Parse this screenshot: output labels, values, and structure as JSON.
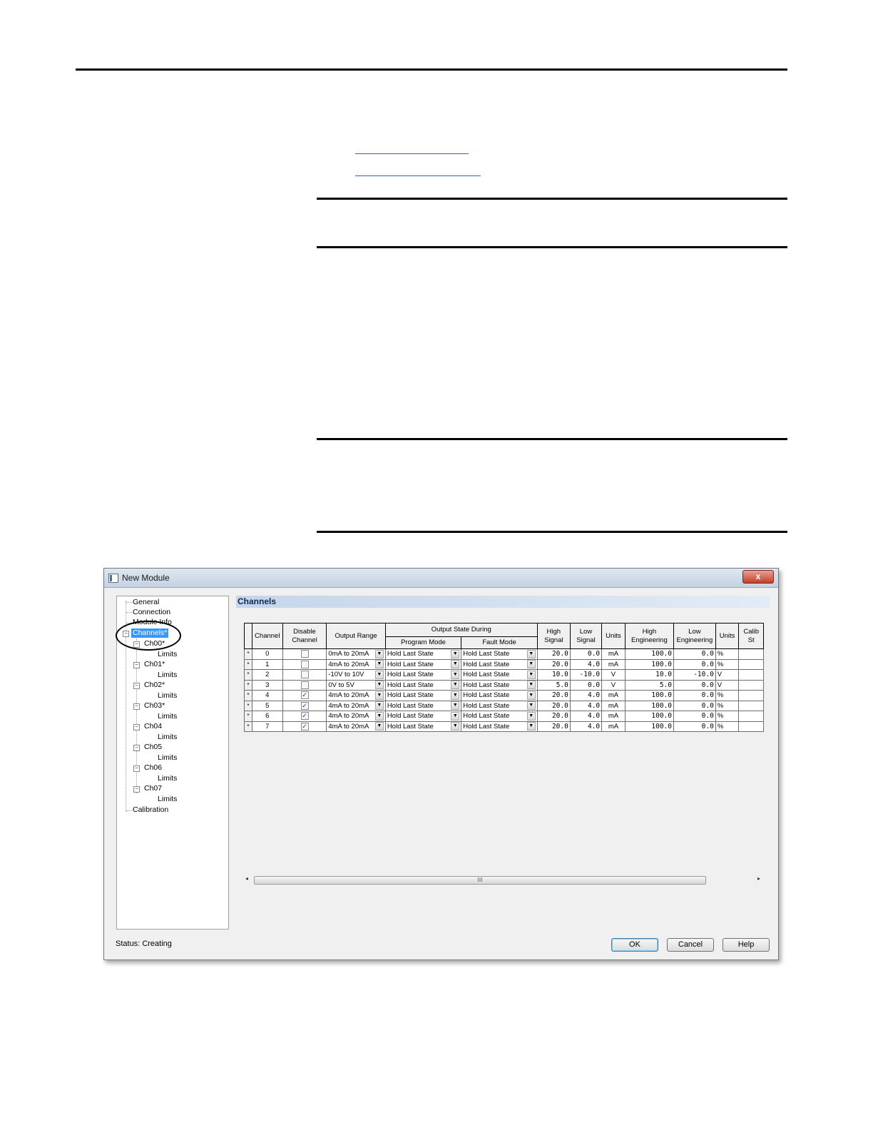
{
  "window": {
    "title": "New Module",
    "close_label": "x"
  },
  "tree": {
    "items": [
      {
        "label": "General"
      },
      {
        "label": "Connection"
      },
      {
        "label": "Module Info"
      },
      {
        "label": "Channels*"
      },
      {
        "label": "Ch00*"
      },
      {
        "label": "Limits"
      },
      {
        "label": "Ch01*"
      },
      {
        "label": "Limits"
      },
      {
        "label": "Ch02*"
      },
      {
        "label": "Limits"
      },
      {
        "label": "Ch03*"
      },
      {
        "label": "Limits"
      },
      {
        "label": "Ch04"
      },
      {
        "label": "Limits"
      },
      {
        "label": "Ch05"
      },
      {
        "label": "Limits"
      },
      {
        "label": "Ch06"
      },
      {
        "label": "Limits"
      },
      {
        "label": "Ch07"
      },
      {
        "label": "Limits"
      },
      {
        "label": "Calibration"
      }
    ],
    "selected": "Channels*"
  },
  "panel": {
    "title": "Channels"
  },
  "table": {
    "headers": {
      "channel": "Channel",
      "disable_channel": "Disable Channel",
      "output_range": "Output Range",
      "output_state_during": "Output State During",
      "program_mode": "Program Mode",
      "fault_mode": "Fault Mode",
      "high_signal": "High Signal",
      "low_signal": "Low Signal",
      "units": "Units",
      "high_engineering": "High Engineering",
      "low_engineering": "Low Engineering",
      "units2": "Units",
      "calib": "Calib St"
    },
    "rows": [
      {
        "marker": "*",
        "channel": "0",
        "disabled": false,
        "range": "0mA to 20mA",
        "program": "Hold Last State",
        "fault": "Hold Last State",
        "high_signal": "20.0",
        "low_signal": "0.0",
        "units": "mA",
        "high_eng": "100.0",
        "low_eng": "0.0",
        "eng_units": "%"
      },
      {
        "marker": "*",
        "channel": "1",
        "disabled": false,
        "range": "4mA to 20mA",
        "program": "Hold Last State",
        "fault": "Hold Last State",
        "high_signal": "20.0",
        "low_signal": "4.0",
        "units": "mA",
        "high_eng": "100.0",
        "low_eng": "0.0",
        "eng_units": "%"
      },
      {
        "marker": "*",
        "channel": "2",
        "disabled": false,
        "range": "-10V to 10V",
        "program": "Hold Last State",
        "fault": "Hold Last State",
        "high_signal": "10.0",
        "low_signal": "-10.0",
        "units": "V",
        "high_eng": "10.0",
        "low_eng": "-10.0",
        "eng_units": "V"
      },
      {
        "marker": "*",
        "channel": "3",
        "disabled": false,
        "range": "0V to 5V",
        "program": "Hold Last State",
        "fault": "Hold Last State",
        "high_signal": "5.0",
        "low_signal": "0.0",
        "units": "V",
        "high_eng": "5.0",
        "low_eng": "0.0",
        "eng_units": "V"
      },
      {
        "marker": "*",
        "channel": "4",
        "disabled": true,
        "range": "4mA to 20mA",
        "program": "Hold Last State",
        "fault": "Hold Last State",
        "high_signal": "20.0",
        "low_signal": "4.0",
        "units": "mA",
        "high_eng": "100.0",
        "low_eng": "0.0",
        "eng_units": "%"
      },
      {
        "marker": "*",
        "channel": "5",
        "disabled": true,
        "range": "4mA to 20mA",
        "program": "Hold Last State",
        "fault": "Hold Last State",
        "high_signal": "20.0",
        "low_signal": "4.0",
        "units": "mA",
        "high_eng": "100.0",
        "low_eng": "0.0",
        "eng_units": "%"
      },
      {
        "marker": "*",
        "channel": "6",
        "disabled": true,
        "range": "4mA to 20mA",
        "program": "Hold Last State",
        "fault": "Hold Last State",
        "high_signal": "20.0",
        "low_signal": "4.0",
        "units": "mA",
        "high_eng": "100.0",
        "low_eng": "0.0",
        "eng_units": "%"
      },
      {
        "marker": "*",
        "channel": "7",
        "disabled": true,
        "range": "4mA to 20mA",
        "program": "Hold Last State",
        "fault": "Hold Last State",
        "high_signal": "20.0",
        "low_signal": "4.0",
        "units": "mA",
        "high_eng": "100.0",
        "low_eng": "0.0",
        "eng_units": "%"
      }
    ]
  },
  "scrollbar": {
    "left_arrow": "◂",
    "right_arrow": "▸",
    "grip": "III"
  },
  "status": {
    "label": "Status:",
    "value": "Creating"
  },
  "buttons": {
    "ok": "OK",
    "cancel": "Cancel",
    "help": "Help"
  },
  "colors": {
    "selection": "#3399ff",
    "panel_header": "#c5d5ea",
    "close_button": "#c2402a"
  }
}
